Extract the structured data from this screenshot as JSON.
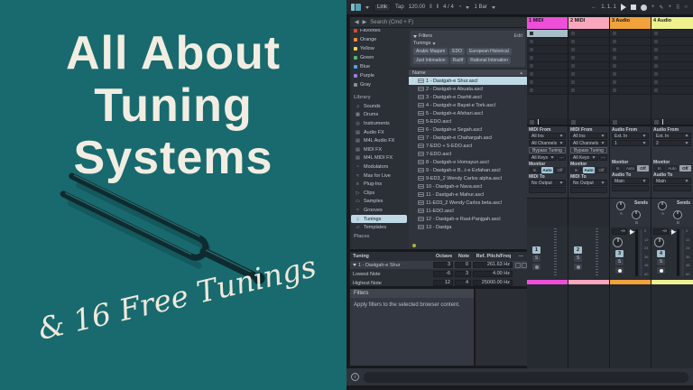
{
  "cover": {
    "title_lines": [
      "All About",
      "Tuning",
      "Systems"
    ],
    "subtitle": "& 16 Free Tunings",
    "bg_color": "#186A6E",
    "text_color": "#F2EDE2"
  },
  "transport": {
    "link": "Link",
    "tap": "Tap",
    "tempo": "120.00",
    "time_signature": "4 / 4",
    "quantize": "1 Bar",
    "position": "1. 1. 1"
  },
  "browser": {
    "search_label": "Search (Cmd + F)",
    "color_labels": [
      {
        "label": "Favorites",
        "color": "#E0452C"
      },
      {
        "label": "Orange",
        "color": "#EC8F3E"
      },
      {
        "label": "Yellow",
        "color": "#EFD84F"
      },
      {
        "label": "Green",
        "color": "#51BD6B"
      },
      {
        "label": "Blue",
        "color": "#55A0E8"
      },
      {
        "label": "Purple",
        "color": "#9D7BE8"
      },
      {
        "label": "Gray",
        "color": "#8A9099"
      }
    ],
    "library_header": "Library",
    "library_items": [
      {
        "label": "Sounds",
        "icon": "♫"
      },
      {
        "label": "Drums",
        "icon": "▦"
      },
      {
        "label": "Instruments",
        "icon": "◎"
      },
      {
        "label": "Audio FX",
        "icon": "▤"
      },
      {
        "label": "M4L Audio FX",
        "icon": "▤"
      },
      {
        "label": "MIDI FX",
        "icon": "▤"
      },
      {
        "label": "M4L MIDI FX",
        "icon": "▤"
      },
      {
        "label": "Modulators",
        "icon": "~"
      },
      {
        "label": "Max for Live",
        "icon": "≈"
      },
      {
        "label": "Plug-Ins",
        "icon": "≡"
      },
      {
        "label": "Clips",
        "icon": "▷"
      },
      {
        "label": "Samples",
        "icon": "▭"
      },
      {
        "label": "Grooves",
        "icon": "≈"
      },
      {
        "label": "Tunings",
        "icon": "ψ",
        "bg": "#BFD9E6",
        "fg": "#15181C"
      },
      {
        "label": "Templates",
        "icon": "▱"
      }
    ],
    "places_label": "Places",
    "filters": {
      "title": "Filters",
      "edit_label": "Edit",
      "group_label": "Tunings",
      "chips": [
        "Arabic Maqam",
        "EDO",
        "European Historical",
        "Just Intonation",
        "Radif",
        "Rational Intonation"
      ]
    },
    "name_header": "Name",
    "files": [
      {
        "name": "1 - Dastgah-e Shur.ascl",
        "bg": "#BFD9E6",
        "fg": "#15181C"
      },
      {
        "name": "2 - Dastgah-e Abuata.ascl"
      },
      {
        "name": "3 - Dastgah-e Dashti.ascl"
      },
      {
        "name": "4 - Dastgah-e Bayat-e Tork.ascl"
      },
      {
        "name": "5 - Dastgah-e Afshari.ascl"
      },
      {
        "name": "5-EDO.ascl"
      },
      {
        "name": "6 - Dastgah-e Segah.ascl"
      },
      {
        "name": "7 - Dastgah-e Chahargah.ascl"
      },
      {
        "name": "7-EDO + 5-EDO.ascl"
      },
      {
        "name": "7-EDO.ascl"
      },
      {
        "name": "8 - Dastgah-e Homayun.ascl"
      },
      {
        "name": "9 - Dastgah-e B...t-e Esfahan.ascl"
      },
      {
        "name": "9-ED3_2 Wendy Carlos alpha.ascl"
      },
      {
        "name": "10 - Dastgah-e Nava.ascl"
      },
      {
        "name": "11 - Dastgah-e Mahur.ascl"
      },
      {
        "name": "11-ED3_2 Wendy Carlos beta.ascl"
      },
      {
        "name": "11-EDO.ascl"
      },
      {
        "name": "12 - Dastgah-e Rast-Panjgah.ascl"
      },
      {
        "name": "13 - Dastga"
      }
    ]
  },
  "tuning_panel": {
    "title": "Tuning",
    "col_octave": "Octave",
    "col_note": "Note",
    "col_ref": "Ref. Pitch/Freq",
    "rows": [
      {
        "label": "1 - Dastgah-e Shur",
        "octave": "3",
        "note": "0",
        "ref": "261.63 Hz"
      },
      {
        "label": "Lowest Note",
        "octave": "-6",
        "note": "3",
        "ref": "4.00 Hz"
      },
      {
        "label": "Highest Note",
        "octave": "12",
        "note": "4",
        "ref": "25000.00 Hz"
      }
    ]
  },
  "help_panel": {
    "title": "Filters",
    "body": "Apply filters to the selected browser content."
  },
  "session": {
    "monitor": [
      "In",
      "Auto",
      "Off"
    ],
    "sends_label": "Sends",
    "send_knobs": [
      "A",
      "B"
    ],
    "fader_scale": [
      "0",
      "12",
      "24",
      "36",
      "48",
      "60"
    ],
    "tracks": [
      {
        "name": "1 MIDI",
        "color": "#ED4FD8",
        "from_label": "MIDI From",
        "from_a": "All Ins",
        "from_b": "All Channels",
        "bypass": "Bypass Tuning",
        "keys": "All Keys",
        "monitor_label": "Monitor",
        "to_label": "MIDI To",
        "to_value": "No Output",
        "num": "1",
        "solo": "S"
      },
      {
        "name": "2 MIDI",
        "color": "#F8A7BC",
        "from_label": "MIDI From",
        "from_a": "All Ins",
        "from_b": "All Channels",
        "bypass": "Bypass Tuning",
        "keys": "All Keys",
        "monitor_label": "Monitor",
        "to_label": "MIDI To",
        "to_value": "No Output",
        "num": "2",
        "solo": "S"
      },
      {
        "name": "3 Audio",
        "color": "#F2A23A",
        "from_label": "Audio From",
        "from_a": "Ext. In",
        "from_b": "1",
        "monitor_label": "Monitor",
        "to_label": "Audio To",
        "to_value": "Main",
        "num": "3",
        "solo": "S",
        "peak": "-∞"
      },
      {
        "name": "4 Audio",
        "color": "#EFF18F",
        "from_label": "Audio From",
        "from_a": "Ext. In",
        "from_b": "2",
        "monitor_label": "Monitor",
        "to_label": "Audio To",
        "to_value": "Main",
        "num": "4",
        "solo": "S",
        "peak": "-∞"
      }
    ]
  }
}
